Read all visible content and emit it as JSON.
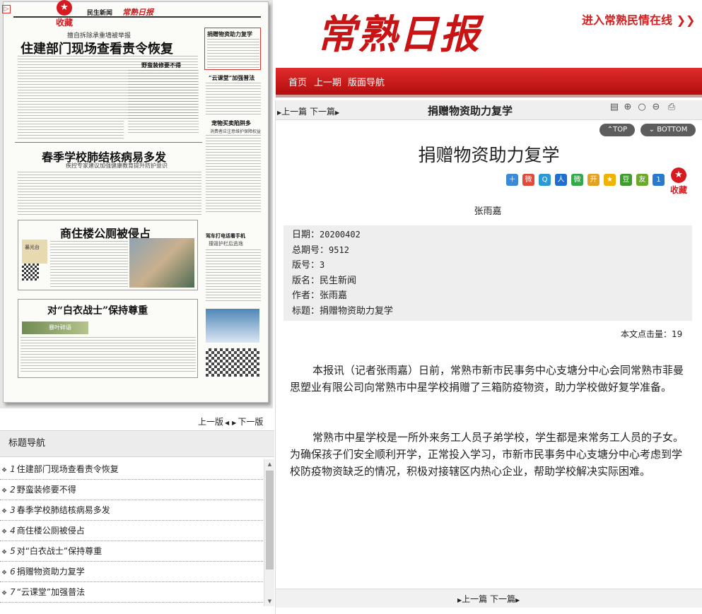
{
  "paper": {
    "corner_arrow": "▷",
    "favorite_label": "收藏",
    "section": "民生新闻",
    "logo": "常熟日报",
    "kicker": "擅自拆除承重墙被举报",
    "headline1": "住建部门现场查看责令恢复",
    "headline2": "野蛮装修要不得",
    "headline3": "春季学校肺结核病易多发",
    "subhead3": "疾控专家建议加强健康教育提升防护意识",
    "headline4": "商住楼公厕被侵占",
    "headline5": "对“白衣战士”保持尊重",
    "box_title": "捐赠物资助力复学",
    "box2_title": "“云课堂”加强普法",
    "box3_title": "宠物买卖陷阱多",
    "box3_sub": "消费者应注意维护保障权益",
    "box4_title": "驾车打电话看手机",
    "box4_sub": "撞毁护栏后逃逸",
    "img_label": "暴叶碎语",
    "img2_label": "暴光台"
  },
  "page_nav": {
    "prev": "上一版",
    "next": "下一版"
  },
  "title_nav": {
    "header": "标题导航",
    "items": [
      {
        "num": "1",
        "label": "住建部门现场查看责令恢复"
      },
      {
        "num": "2",
        "label": "野蛮装修要不得"
      },
      {
        "num": "3",
        "label": "春季学校肺结核病易多发"
      },
      {
        "num": "4",
        "label": "商住楼公厕被侵占"
      },
      {
        "num": "5",
        "label": "对“白衣战士”保持尊重"
      },
      {
        "num": "6",
        "label": "捐赠物资助力复学"
      },
      {
        "num": "7",
        "label": "“云课堂”加强普法"
      }
    ]
  },
  "header": {
    "logo": "常熟日报",
    "enter_link": "进入常熟民情在线 ❯❯",
    "nav": [
      "首页",
      "上一期",
      "版面导航"
    ]
  },
  "article_bar": {
    "prev": "上一篇",
    "next": "下一篇",
    "title": "捐赠物资助力复学",
    "top_btn": "⌃TOP",
    "bottom_btn": "⌄ BOTTOM"
  },
  "article": {
    "title": "捐赠物资助力复学",
    "author": "张雨嘉",
    "favorite_label": "收藏",
    "meta": {
      "date_label": "日期：",
      "date": "20200402",
      "issue_label": "总期号：",
      "issue": "9512",
      "page_label": "版号：",
      "page": "3",
      "section_label": "版名：",
      "section": "民生新闻",
      "author_label": "作者：",
      "author": "张雨嘉",
      "title_label": "标题：",
      "title": "捐赠物资助力复学"
    },
    "hits_label": "本文点击量：",
    "hits": "19",
    "para1": "本报讯（记者张雨嘉）日前，常熟市新市民事务中心支塘分中心会同常熟市菲曼思塑业有限公司向常熟市中星学校捐赠了三箱防疫物资，助力学校做好复学准备。",
    "para2": "常熟市中星学校是一所外来务工人员子弟学校，学生都是来常务工人员的子女。为确保孩子们安全顺利开学，正常投入学习，市新市民事务中心支塘分中心考虑到学校防疫物资缺乏的情况，积极对接辖区内热心企业，帮助学校解决实际困难。"
  },
  "bottom_nav": {
    "prev": "上一篇",
    "next": "下一篇"
  },
  "colors": {
    "brand_red": "#c81414",
    "nav_red": "#d02020"
  }
}
